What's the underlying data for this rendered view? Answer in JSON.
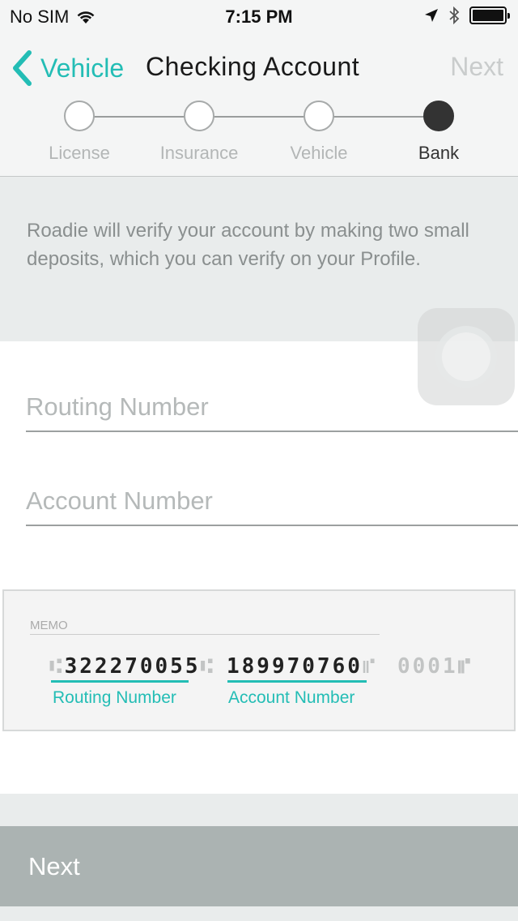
{
  "status_bar": {
    "carrier": "No SIM",
    "time": "7:15 PM",
    "icons": [
      "wifi-icon",
      "location-arrow-icon",
      "bluetooth-icon",
      "battery-icon"
    ]
  },
  "nav": {
    "back_label": "Vehicle",
    "title": "Checking Account",
    "next_label": "Next"
  },
  "steps": [
    {
      "label": "License",
      "active": false
    },
    {
      "label": "Insurance",
      "active": false
    },
    {
      "label": "Vehicle",
      "active": false
    },
    {
      "label": "Bank",
      "active": true
    }
  ],
  "info_text": "Roadie will verify your account by making two small deposits, which you can verify on your Profile.",
  "form": {
    "routing_placeholder": "Routing Number",
    "account_placeholder": "Account Number"
  },
  "check": {
    "memo_label": "MEMO",
    "routing_number": "322270055",
    "account_number": "189970760",
    "check_number": "0001",
    "routing_caption": "Routing Number",
    "account_caption": "Account Number"
  },
  "bottom_button": "Next",
  "colors": {
    "accent": "#23bdb5",
    "button_bg": "#abb3b2"
  }
}
